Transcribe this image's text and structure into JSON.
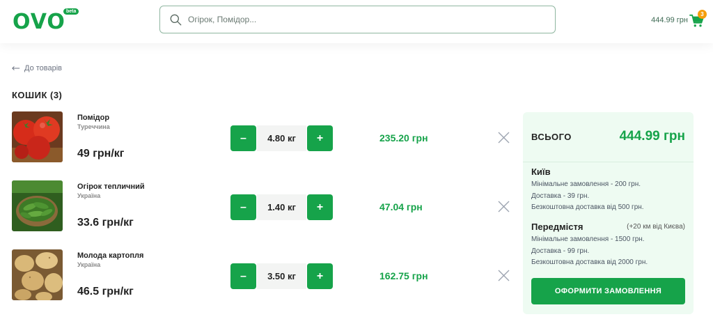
{
  "brand": {
    "name": "OVO",
    "badge": "beta",
    "color": "#16a34a"
  },
  "search": {
    "placeholder": "Огірок, Помідор..."
  },
  "header_cart": {
    "total": "444.99 грн",
    "count": "3"
  },
  "back_link": "До товарів",
  "cart_title": "КОШИК (3)",
  "items": [
    {
      "name": "Помідор",
      "origin": "Туреччина",
      "unit_price": "49 грн/кг",
      "qty": "4.80 кг",
      "total": "235.20 грн",
      "minus": "–",
      "plus": "+"
    },
    {
      "name": "Огірок тепличний",
      "origin": "Україна",
      "unit_price": "33.6 грн/кг",
      "qty": "1.40 кг",
      "total": "47.04 грн",
      "minus": "–",
      "plus": "+"
    },
    {
      "name": "Молода картопля",
      "origin": "Україна",
      "unit_price": "46.5 грн/кг",
      "qty": "3.50 кг",
      "total": "162.75 грн",
      "minus": "–",
      "plus": "+"
    }
  ],
  "summary": {
    "label": "ВСЬОГО",
    "value": "444.99 грн",
    "kyiv": {
      "title": "Київ",
      "lines": [
        "Мінімальне замовлення - 200 грн.",
        "Доставка - 39 грн.",
        "Безкоштовна доставка від 500 грн."
      ]
    },
    "suburb": {
      "title": "Передмістя",
      "note": "(+20 км від Києва)",
      "lines": [
        "Мінімальне замовлення - 1500 грн.",
        "Доставка - 99 грн.",
        "Безкоштовна доставка від 2000 грн."
      ]
    },
    "checkout_label": "ОФОРМИТИ ЗАМОВЛЕННЯ"
  },
  "icons": {
    "search": "search-icon",
    "cart": "cart-icon",
    "back": "arrow-left-icon",
    "remove": "close-icon"
  }
}
